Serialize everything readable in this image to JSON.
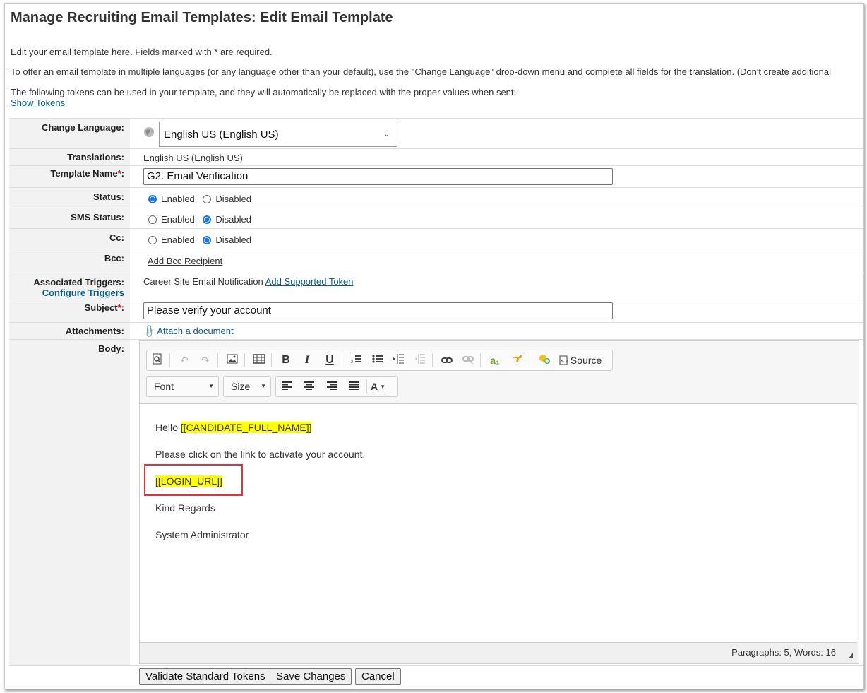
{
  "page": {
    "title": "Manage Recruiting Email Templates: Edit Email Template",
    "intro_required": "Edit your email template here. Fields marked with * are required.",
    "intro_languages": "To offer an email template in multiple languages (or any language other than your default), use the \"Change Language\" drop-down menu and complete all fields for the translation. (Don't create additional",
    "intro_tokens": "The following tokens can be used in your template, and they will automatically be replaced with the proper values when sent:",
    "show_tokens_link": "Show Tokens"
  },
  "form": {
    "change_language": {
      "label": "Change Language:",
      "selected": "English US (English US)",
      "icon": "globe-icon"
    },
    "translations": {
      "label": "Translations:",
      "value": "English US (English US)"
    },
    "template_name": {
      "label": "Template Name",
      "required_mark": "*",
      "colon": ":",
      "value": "G2. Email Verification"
    },
    "status": {
      "label": "Status:",
      "enabled": "Enabled",
      "disabled": "Disabled",
      "selected": "Enabled"
    },
    "sms_status": {
      "label": "SMS Status:",
      "enabled": "Enabled",
      "disabled": "Disabled",
      "selected": "Disabled"
    },
    "cc": {
      "label": "Cc:",
      "enabled": "Enabled",
      "disabled": "Disabled",
      "selected": "Disabled"
    },
    "bcc": {
      "label": "Bcc:",
      "link": "Add Bcc Recipient"
    },
    "triggers": {
      "label": "Associated Triggers:",
      "configure_link": "Configure Triggers",
      "value": "Career Site Email Notification",
      "add_token_link": "Add Supported Token"
    },
    "subject": {
      "label": "Subject",
      "required_mark": "*",
      "colon": ":",
      "value": "Please verify your account"
    },
    "attachments": {
      "label": "Attachments:",
      "link": "Attach a document",
      "icon": "paperclip-icon"
    },
    "body": {
      "label": "Body:"
    }
  },
  "editor": {
    "toolbar": {
      "source_label": "Source",
      "font_label": "Font",
      "size_label": "Size",
      "bold": "B",
      "italic": "I",
      "underline": "U",
      "text_color": "A"
    },
    "content": {
      "greeting": "Hello ",
      "token_name": "[[CANDIDATE_FULL_NAME]]",
      "line2": "Please click on the link to activate your account.",
      "token_url": "[[LOGIN_URL]]",
      "line4": "Kind Regards",
      "line5": "System Administrator"
    },
    "status": "Paragraphs: 5, Words: 16",
    "highlight_color": "#ffff00",
    "annotation_color": "#d9363e"
  },
  "buttons": {
    "validate": "Validate Standard Tokens",
    "save": "Save Changes",
    "cancel": "Cancel"
  }
}
